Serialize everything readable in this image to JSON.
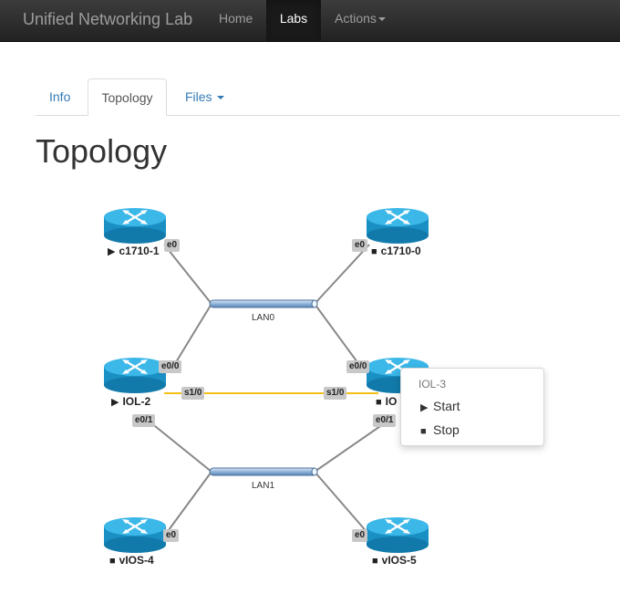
{
  "navbar": {
    "brand": "Unified Networking Lab",
    "items": [
      "Home",
      "Labs",
      "Actions"
    ]
  },
  "tabs": [
    "Info",
    "Topology",
    "Files"
  ],
  "page_title": "Topology",
  "nodes": [
    {
      "name": "c1710-1",
      "state_icon": "play-icon"
    },
    {
      "name": "c1710-0",
      "state_icon": "stop-icon"
    },
    {
      "name": "IOL-2",
      "state_icon": "play-icon"
    },
    {
      "name": "IOL-3",
      "display": "IO",
      "state_icon": "stop-icon"
    },
    {
      "name": "vIOS-4",
      "state_icon": "stop-icon"
    },
    {
      "name": "vIOS-5",
      "state_icon": "stop-icon"
    }
  ],
  "networks": [
    "LAN0",
    "LAN1"
  ],
  "interfaces": {
    "c1710_1_e0": "e0",
    "c1710_0_e0": "e0",
    "iol2_e00": "e0/0",
    "iol2_s10": "s1/0",
    "iol2_e01": "e0/1",
    "iol3_e00": "e0/0",
    "iol3_s10": "s1/0",
    "iol3_e01": "e0/1",
    "vios4_e0": "e0",
    "vios5_e0": "e0"
  },
  "context_menu": {
    "header": "IOL-3",
    "items": [
      "Start",
      "Stop"
    ]
  },
  "colors": {
    "router": "#1fa3d9",
    "serial_link": "#f5c016",
    "ethernet_link": "#888888",
    "accent": "#337ab7"
  }
}
